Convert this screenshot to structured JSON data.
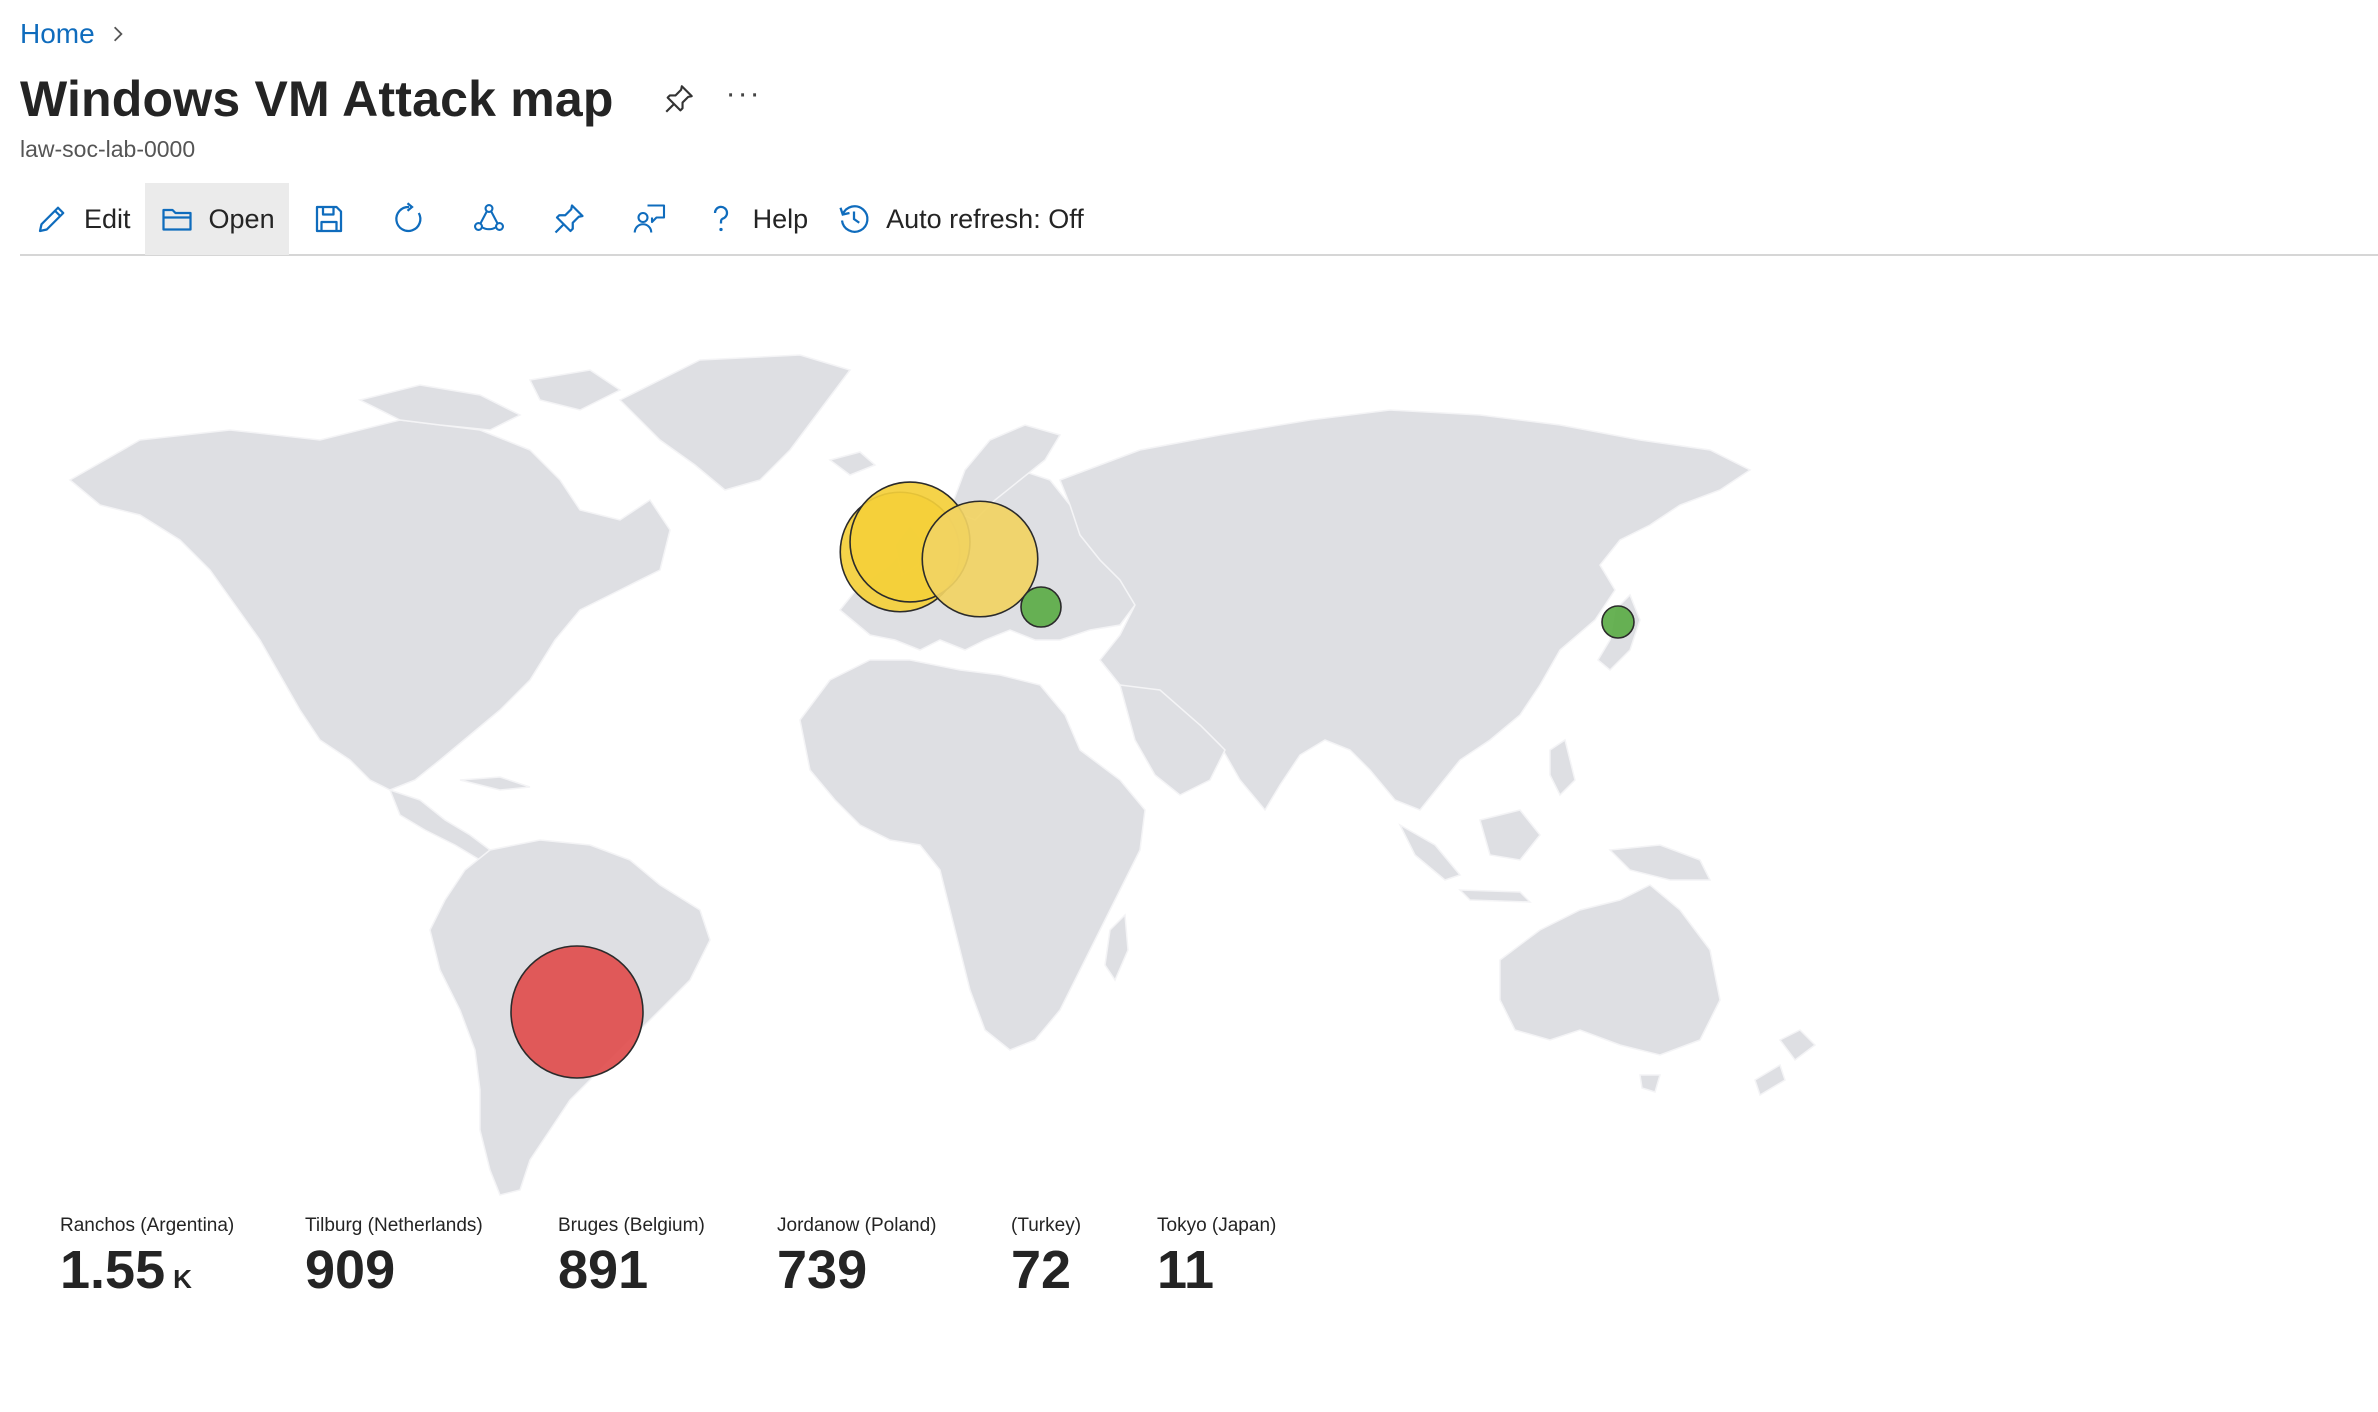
{
  "breadcrumb": {
    "home": "Home"
  },
  "header": {
    "title": "Windows VM Attack map",
    "subtitle": "law-soc-lab-0000",
    "more": "···"
  },
  "toolbar": {
    "edit": "Edit",
    "open": "Open",
    "help": "Help",
    "auto_refresh": "Auto refresh: Off"
  },
  "map": {
    "land_color": "#dedfe3",
    "points": [
      {
        "location": "Ranchos (Argentina)",
        "count": 1550,
        "color": "#df4d4d"
      },
      {
        "location": "Tilburg (Netherlands)",
        "count": 909,
        "color": "#f4cf3a"
      },
      {
        "location": "Bruges (Belgium)",
        "count": 891,
        "color": "#f4cf3a"
      },
      {
        "location": "Jordanow (Poland)",
        "count": 739,
        "color": "#f1d363"
      },
      {
        "location": "(Turkey)",
        "count": 72,
        "color": "#5bab47"
      },
      {
        "location": "Tokyo (Japan)",
        "count": 11,
        "color": "#5bab47"
      }
    ]
  },
  "legend": {
    "items": [
      {
        "label": "Ranchos (Argentina)",
        "value": "1.55",
        "unit": "K"
      },
      {
        "label": "Tilburg (Netherlands)",
        "value": "909",
        "unit": ""
      },
      {
        "label": "Bruges (Belgium)",
        "value": "891",
        "unit": ""
      },
      {
        "label": "Jordanow (Poland)",
        "value": "739",
        "unit": ""
      },
      {
        "label": "(Turkey)",
        "value": "72",
        "unit": ""
      },
      {
        "label": "Tokyo (Japan)",
        "value": "11",
        "unit": ""
      }
    ]
  }
}
